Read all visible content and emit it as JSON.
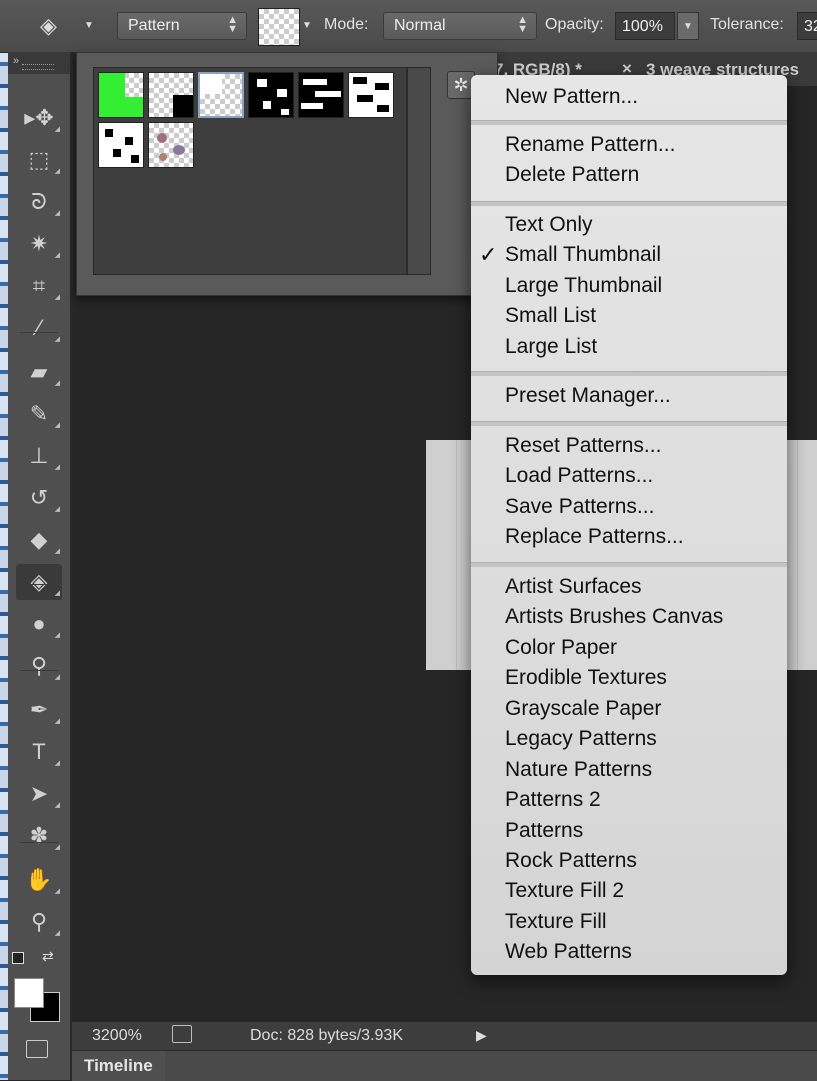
{
  "options_bar": {
    "fill_source": "Pattern",
    "mode_label": "Mode:",
    "mode_value": "Normal",
    "opacity_label": "Opacity:",
    "opacity_value": "100%",
    "tolerance_label": "Tolerance:",
    "tolerance_value": "32"
  },
  "document": {
    "tab_1": "7, RGB/8) *",
    "tab_2_close": "×",
    "tab_2": "3 weave structures"
  },
  "toolbox": {
    "collapse_glyph": "»",
    "tools": [
      {
        "name": "move-tool",
        "icon": "move-icon",
        "glyph": "▸✥"
      },
      {
        "name": "marquee-tool",
        "icon": "marquee-icon",
        "glyph": "⬚"
      },
      {
        "name": "lasso-tool",
        "icon": "lasso-icon",
        "glyph": "ᘐ"
      },
      {
        "name": "magic-wand-tool",
        "icon": "magic-wand-icon",
        "glyph": "✷"
      },
      {
        "name": "crop-tool",
        "icon": "crop-icon",
        "glyph": "⌗"
      },
      {
        "name": "eyedropper-tool",
        "icon": "eyedropper-icon",
        "glyph": "⁄"
      },
      {
        "name": "healing-brush-tool",
        "icon": "bandage-icon",
        "glyph": "▰"
      },
      {
        "name": "brush-tool",
        "icon": "brush-icon",
        "glyph": "✎"
      },
      {
        "name": "clone-stamp-tool",
        "icon": "stamp-icon",
        "glyph": "⊥"
      },
      {
        "name": "history-brush-tool",
        "icon": "history-brush-icon",
        "glyph": "↺"
      },
      {
        "name": "eraser-tool",
        "icon": "eraser-icon",
        "glyph": "◆"
      },
      {
        "name": "paint-bucket-tool",
        "icon": "paint-bucket-icon",
        "glyph": "◈"
      },
      {
        "name": "blur-tool",
        "icon": "drop-icon",
        "glyph": "●"
      },
      {
        "name": "dodge-tool",
        "icon": "dodge-icon",
        "glyph": "⚲"
      },
      {
        "name": "pen-tool",
        "icon": "pen-icon",
        "glyph": "✒"
      },
      {
        "name": "type-tool",
        "icon": "type-icon",
        "glyph": "T"
      },
      {
        "name": "path-selection-tool",
        "icon": "arrow-icon",
        "glyph": "➤"
      },
      {
        "name": "custom-shape-tool",
        "icon": "shape-icon",
        "glyph": "✽"
      },
      {
        "name": "hand-tool",
        "icon": "hand-icon",
        "glyph": "✋"
      },
      {
        "name": "zoom-tool",
        "icon": "zoom-icon",
        "glyph": "⚲"
      }
    ]
  },
  "status_bar": {
    "zoom": "3200%",
    "doc_info": "Doc: 828 bytes/3.93K"
  },
  "timeline": {
    "label": "Timeline"
  },
  "pattern_picker": {
    "gear_glyph": "✲"
  },
  "context_menu": {
    "items": [
      {
        "label": "New Pattern...",
        "checked": false
      },
      {
        "label": "Rename Pattern...",
        "checked": false
      },
      {
        "label": "Delete Pattern",
        "checked": false
      },
      {
        "label": "Text Only",
        "checked": false
      },
      {
        "label": "Small Thumbnail",
        "checked": true
      },
      {
        "label": "Large Thumbnail",
        "checked": false
      },
      {
        "label": "Small List",
        "checked": false
      },
      {
        "label": "Large List",
        "checked": false
      },
      {
        "label": "Preset Manager...",
        "checked": false
      },
      {
        "label": "Reset Patterns...",
        "checked": false
      },
      {
        "label": "Load Patterns...",
        "checked": false
      },
      {
        "label": "Save Patterns...",
        "checked": false
      },
      {
        "label": "Replace Patterns...",
        "checked": false
      },
      {
        "label": "Artist Surfaces",
        "checked": false
      },
      {
        "label": "Artists Brushes Canvas",
        "checked": false
      },
      {
        "label": "Color Paper",
        "checked": false
      },
      {
        "label": "Erodible Textures",
        "checked": false
      },
      {
        "label": "Grayscale Paper",
        "checked": false
      },
      {
        "label": "Legacy Patterns",
        "checked": false
      },
      {
        "label": "Nature Patterns",
        "checked": false
      },
      {
        "label": "Patterns 2",
        "checked": false
      },
      {
        "label": "Patterns",
        "checked": false
      },
      {
        "label": "Rock Patterns",
        "checked": false
      },
      {
        "label": "Texture Fill 2",
        "checked": false
      },
      {
        "label": "Texture Fill",
        "checked": false
      },
      {
        "label": "Web Patterns",
        "checked": false
      }
    ],
    "check_glyph": "✓"
  },
  "colors": {
    "menu_bg": "#dcdcdc",
    "panel_bg": "#5a5a5a",
    "app_bg": "#262626",
    "swatch_green": "#33ee33"
  }
}
